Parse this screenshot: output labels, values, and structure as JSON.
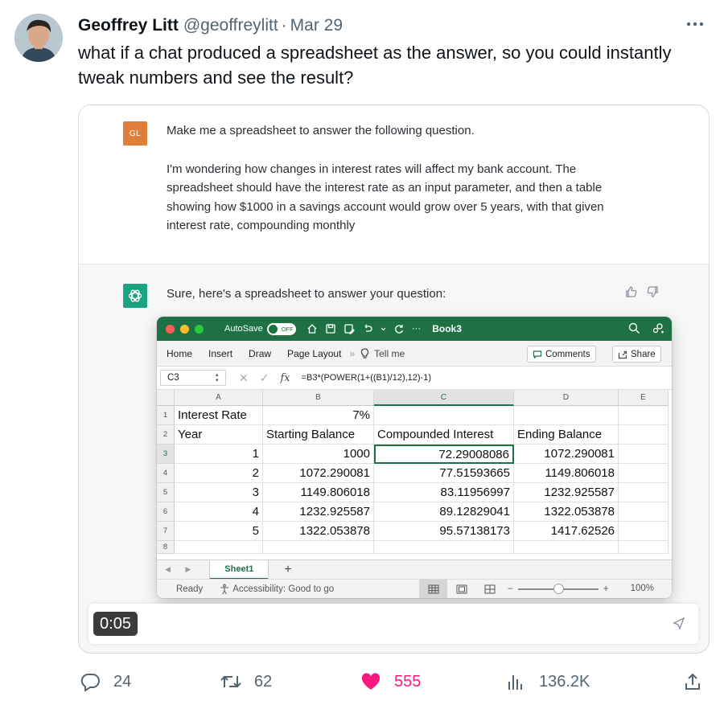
{
  "tweet": {
    "author_name": "Geoffrey Litt",
    "handle": "@geoffreylitt",
    "separator": "·",
    "date": "Mar 29",
    "text": "what if a chat produced a spreadsheet as the answer, so you could instantly tweak numbers and see the result?"
  },
  "chat": {
    "user_initials": "GL",
    "user_message_line1": "Make me a spreadsheet to answer the following question.",
    "user_message_line2": "I'm wondering how changes in interest rates will affect my bank account. The spreadsheet should have the interest rate as an input parameter, and then a table showing how $1000 in a savings account would grow over 5 years, with that given interest rate, compounding monthly",
    "assistant_message": "Sure, here's a spreadsheet to answer your question:",
    "video_time": "0:05"
  },
  "excel": {
    "autosave_label": "AutoSave",
    "autosave_state": "OFF",
    "more": "···",
    "book_name": "Book3",
    "ribbon_tabs": [
      "Home",
      "Insert",
      "Draw",
      "Page Layout"
    ],
    "ribbon_chevron": "»",
    "tell_me": "Tell me",
    "comments_label": "Comments",
    "share_label": "Share",
    "name_box": "C3",
    "formula": "=B3*(POWER(1+((B1)/12),12)-1)",
    "columns": [
      "A",
      "B",
      "C",
      "D",
      "E"
    ],
    "row_numbers": [
      "1",
      "2",
      "3",
      "4",
      "5",
      "6",
      "7",
      "8"
    ],
    "cells": {
      "A1": "Interest Rate",
      "B1": "7%",
      "A2": "Year",
      "B2": "Starting Balance",
      "C2": "Compounded Interest",
      "D2": "Ending Balance",
      "A3": "1",
      "B3": "1000",
      "C3": "72.29008086",
      "D3": "1072.290081",
      "A4": "2",
      "B4": "1072.290081",
      "C4": "77.51593665",
      "D4": "1149.806018",
      "A5": "3",
      "B5": "1149.806018",
      "C5": "83.11956997",
      "D5": "1232.925587",
      "A6": "4",
      "B6": "1232.925587",
      "C6": "89.12829041",
      "D6": "1322.053878",
      "A7": "5",
      "B7": "1322.053878",
      "C7": "95.57138173",
      "D7": "1417.62526"
    },
    "sheet_tab": "Sheet1",
    "add_sheet": "+",
    "status_ready": "Ready",
    "status_accessibility": "Accessibility: Good to go",
    "zoom_minus": "−",
    "zoom_plus": "+",
    "zoom_level": "100%",
    "zoom_fraction": 0.5,
    "accent_color": "#1e7145"
  },
  "stats": {
    "replies": "24",
    "retweets": "62",
    "likes": "555",
    "views": "136.2K"
  },
  "colors": {
    "like": "#f91880",
    "muted": "#536471",
    "chatgpt_green": "#19a37f",
    "user_badge": "#e07e3c"
  }
}
